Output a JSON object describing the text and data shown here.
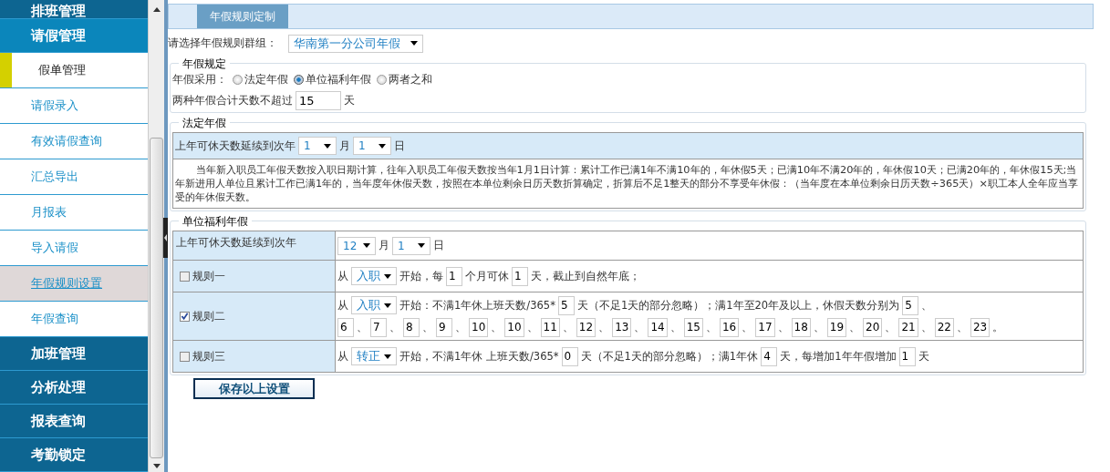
{
  "sidebar": {
    "items": [
      {
        "kind": "group",
        "label": "排班管理",
        "selected": false
      },
      {
        "kind": "group",
        "label": "请假管理",
        "selected": true
      },
      {
        "kind": "subgroup",
        "label": "假单管理"
      },
      {
        "kind": "link",
        "label": "请假录入",
        "selected": false
      },
      {
        "kind": "link",
        "label": "有效请假查询",
        "selected": false
      },
      {
        "kind": "link",
        "label": "汇总导出",
        "selected": false
      },
      {
        "kind": "link",
        "label": "月报表",
        "selected": false
      },
      {
        "kind": "link",
        "label": "导入请假",
        "selected": false
      },
      {
        "kind": "link",
        "label": "年假规则设置",
        "selected": true
      },
      {
        "kind": "link",
        "label": "年假查询",
        "selected": false
      },
      {
        "kind": "group",
        "label": "加班管理",
        "selected": false
      },
      {
        "kind": "group",
        "label": "分析处理",
        "selected": false
      },
      {
        "kind": "group",
        "label": "报表查询",
        "selected": false
      },
      {
        "kind": "group",
        "label": "考勤锁定",
        "selected": false
      }
    ]
  },
  "tabs": [
    {
      "label": "年假规则定制",
      "selected": true
    }
  ],
  "group_select": {
    "label": "请选择年假规则群组：",
    "value": "华南第一分公司年假"
  },
  "annual_rule": {
    "legend": "年假规定",
    "mode_label": "年假采用：",
    "options": [
      {
        "label": "法定年假",
        "selected": false
      },
      {
        "label": "单位福利年假",
        "selected": true
      },
      {
        "label": "两者之和",
        "selected": false
      }
    ],
    "total_label": "两种年假合计天数不超过",
    "total_value": "15",
    "total_unit": "天"
  },
  "statutory": {
    "legend": "法定年假",
    "carry_label": "上年可休天数延续到次年",
    "month": "1",
    "month_unit": "月",
    "day": "1",
    "day_unit": "日",
    "note": "当年新入职员工年假天数按入职日期计算，往年入职员工年假天数按当年1月1日计算：累计工作已满1年不满10年的，年休假5天；已满10年不满20年的，年休假10天；已满20年的，年休假15天;当年新进用人单位且累计工作已满1年的，当年度年休假天数，按照在本单位剩余日历天数折算确定，折算后不足1整天的部分不享受年休假：（当年度在本单位剩余日历天数÷365天）×职工本人全年应当享受的年休假天数。"
  },
  "welfare": {
    "legend": "单位福利年假",
    "carry_label": "上年可休天数延续到次年",
    "month": "12",
    "month_unit": "月",
    "day": "1",
    "day_unit": "日",
    "rules": [
      {
        "label": "规则一",
        "checked": false,
        "lines": [
          [
            {
              "kind": "text",
              "text": "从"
            },
            {
              "kind": "select",
              "value": "入职"
            },
            {
              "kind": "text",
              "text": "开始，每"
            },
            {
              "kind": "input",
              "value": "1"
            },
            {
              "kind": "text",
              "text": "个月可休"
            },
            {
              "kind": "input",
              "value": "1"
            },
            {
              "kind": "text",
              "text": "天，截止到自然年底；"
            }
          ]
        ]
      },
      {
        "label": "规则二",
        "checked": true,
        "lines": [
          [
            {
              "kind": "text",
              "text": "从"
            },
            {
              "kind": "select",
              "value": "入职"
            },
            {
              "kind": "text",
              "text": "开始：不满1年休上班天数/365*"
            },
            {
              "kind": "input",
              "value": "5"
            },
            {
              "kind": "text",
              "text": "天（不足1天的部分忽略）；满1年至20年及以上，休假天数分别为"
            },
            {
              "kind": "input",
              "value": "5"
            },
            {
              "kind": "text",
              "text": "、"
            }
          ],
          [
            {
              "kind": "input",
              "value": "6"
            },
            {
              "kind": "text",
              "text": "、"
            },
            {
              "kind": "input",
              "value": "7"
            },
            {
              "kind": "text",
              "text": "、"
            },
            {
              "kind": "input",
              "value": "8"
            },
            {
              "kind": "text",
              "text": "、"
            },
            {
              "kind": "input",
              "value": "9"
            },
            {
              "kind": "text",
              "text": "、"
            },
            {
              "kind": "input",
              "value": "10"
            },
            {
              "kind": "text",
              "text": "、"
            },
            {
              "kind": "input",
              "value": "10"
            },
            {
              "kind": "text",
              "text": "、"
            },
            {
              "kind": "input",
              "value": "11"
            },
            {
              "kind": "text",
              "text": "、"
            },
            {
              "kind": "input",
              "value": "12"
            },
            {
              "kind": "text",
              "text": "、"
            },
            {
              "kind": "input",
              "value": "13"
            },
            {
              "kind": "text",
              "text": "、"
            },
            {
              "kind": "input",
              "value": "14"
            },
            {
              "kind": "text",
              "text": "、"
            },
            {
              "kind": "input",
              "value": "15"
            },
            {
              "kind": "text",
              "text": "、"
            },
            {
              "kind": "input",
              "value": "16"
            },
            {
              "kind": "text",
              "text": "、"
            },
            {
              "kind": "input",
              "value": "17"
            },
            {
              "kind": "text",
              "text": "、"
            },
            {
              "kind": "input",
              "value": "18"
            },
            {
              "kind": "text",
              "text": "、"
            },
            {
              "kind": "input",
              "value": "19"
            },
            {
              "kind": "text",
              "text": "、"
            },
            {
              "kind": "input",
              "value": "20"
            },
            {
              "kind": "text",
              "text": "、"
            },
            {
              "kind": "input",
              "value": "21"
            },
            {
              "kind": "text",
              "text": "、"
            },
            {
              "kind": "input",
              "value": "22"
            },
            {
              "kind": "text",
              "text": "、"
            },
            {
              "kind": "input",
              "value": "23"
            },
            {
              "kind": "text",
              "text": "。"
            }
          ]
        ]
      },
      {
        "label": "规则三",
        "checked": false,
        "lines": [
          [
            {
              "kind": "text",
              "text": "从"
            },
            {
              "kind": "select",
              "value": "转正"
            },
            {
              "kind": "text",
              "text": "开始，不满1年休 上班天数/365*"
            },
            {
              "kind": "input",
              "value": "0"
            },
            {
              "kind": "text",
              "text": "天（不足1天的部分忽略）；满1年休"
            },
            {
              "kind": "input",
              "value": "4"
            },
            {
              "kind": "text",
              "text": "天，每增加1年年假增加"
            },
            {
              "kind": "input",
              "value": "1"
            },
            {
              "kind": "text",
              "text": "天"
            }
          ]
        ]
      }
    ]
  },
  "save_button": "保存以上设置"
}
